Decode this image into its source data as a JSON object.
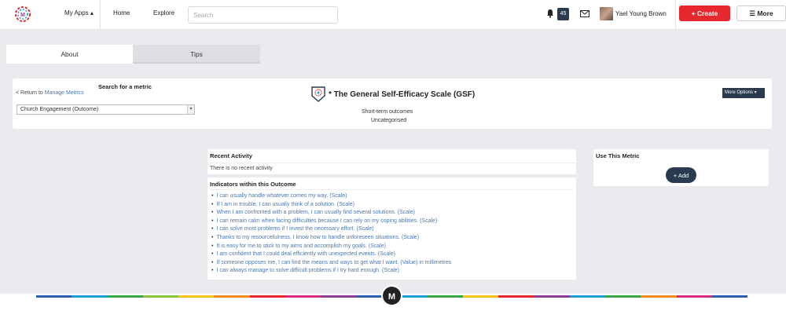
{
  "header": {
    "nav": [
      {
        "label": "My Apps ▴"
      },
      {
        "label": "Home"
      },
      {
        "label": "Explore"
      }
    ],
    "search_placeholder": "Search",
    "notification_count": "45",
    "user_name": "Yael Young Brown",
    "create_label": "+ Create",
    "more_label": "☰ More"
  },
  "tabs": [
    {
      "label": "About",
      "active": true
    },
    {
      "label": "Tips",
      "active": false
    }
  ],
  "metric": {
    "search_label": "Search for a metric",
    "return_text": "< Return to ",
    "return_link": "Manage Metrics",
    "selected_outcome": "Church Engagement (Outcome)",
    "title": "* The General Self-Efficacy Scale (GSF)",
    "more_options": "More Options ▾",
    "category": "Short-term outcomes",
    "status": "Uncategorised"
  },
  "recent_activity": {
    "title": "Recent Activity",
    "text": "There is no recent activity"
  },
  "indicators": {
    "title": "Indicators within this Outcome",
    "items": [
      "I can usually handle whatever comes my way. (Scale)",
      "If I am in trouble, I can usually think of a solution. (Scale)",
      "When I am confronted with a problem, I can usually find several solutions. (Scale)",
      "I can remain calm when facing difficulties because I can rely on my coping abilities. (Scale)",
      "I can solve most problems if I invest the necessary effort. (Scale)",
      "Thanks to my resourcefulness, I know how to handle unforeseen situations. (Scale)",
      "It is easy for me to stick to my aims and accomplish my goals. (Scale)",
      "I am confident that I could deal efficiently with unexpected events. (Scale)",
      "If someone opposes me, I can find the means and ways to get what I want. (Value) in millimetres",
      "I can always manage to solve difficult problems if I try hard enough. (Scale)"
    ]
  },
  "use_metric": {
    "title": "Use This Metric",
    "add_label": "+ Add"
  },
  "footer": {
    "logo_letter": "M",
    "stripe_colors": [
      "#2f5fb3",
      "#1aa0d8",
      "#35a845",
      "#8bc53f",
      "#f7c21e",
      "#f28c1e",
      "#e6272d",
      "#d62a7a",
      "#8e3c97",
      "#2f5fb3",
      "#1aa0d8",
      "#35a845",
      "#f7c21e",
      "#e6272d",
      "#8e3c97",
      "#1aa0d8",
      "#35a845",
      "#f28c1e",
      "#d62a7a",
      "#2f5fb3"
    ]
  },
  "colors": {
    "accent_red": "#e6272d",
    "dark_navy": "#2a3a4f",
    "link_blue": "#4a78b5"
  }
}
